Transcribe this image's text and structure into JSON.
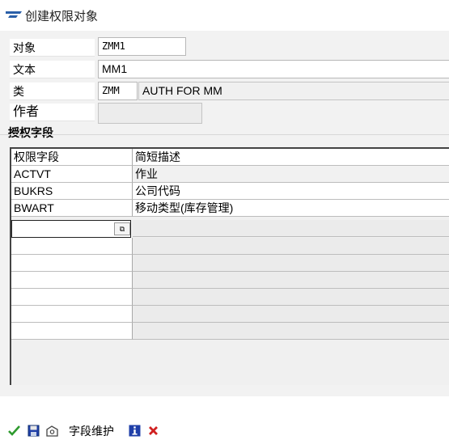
{
  "window": {
    "title": "创建权限对象"
  },
  "form": {
    "object_label": "对象",
    "object_value": "ZMM1",
    "text_label": "文本",
    "text_value": "MM1",
    "class_label": "类",
    "class_value": "ZMM",
    "class_desc": "AUTH FOR MM",
    "author_label": "作者",
    "author_value": ""
  },
  "section": {
    "title": "授权字段"
  },
  "table": {
    "columns": [
      "权限字段",
      "简短描述"
    ],
    "rows": [
      {
        "field": "ACTVT",
        "desc": "作业"
      },
      {
        "field": "BUKRS",
        "desc": "公司代码"
      },
      {
        "field": "BWART",
        "desc": "移动类型(库存管理)"
      }
    ]
  },
  "toolbar": {
    "field_maintain_label": "字段维护"
  },
  "colors": {
    "accent_blue": "#2a5fa8",
    "ok_green": "#2e9a2e",
    "cancel_red": "#d02020",
    "info_blue": "#1f3fa8"
  }
}
